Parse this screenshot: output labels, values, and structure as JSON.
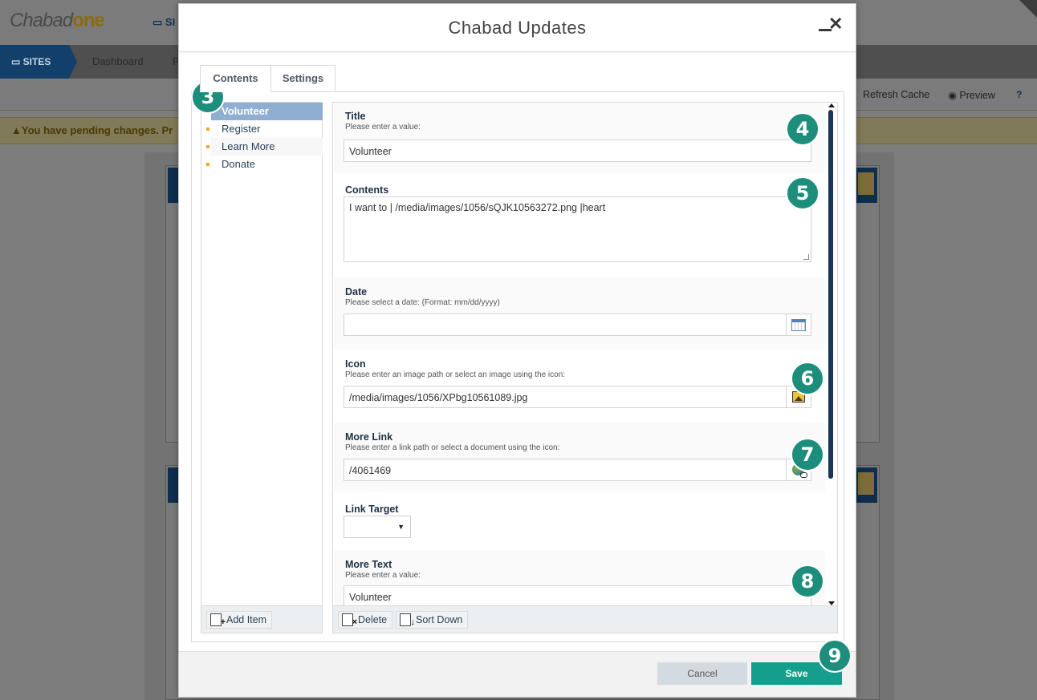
{
  "background": {
    "logo_prefix": "Chabad",
    "logo_suffix": "one",
    "site_label": "SI",
    "nav": {
      "sites": "SITES",
      "dashboard": "Dashboard",
      "next": "P"
    },
    "toolbar": {
      "refresh": "Refresh Cache",
      "preview": "Preview",
      "help": "?"
    },
    "pending": "You have pending changes. Pr"
  },
  "modal": {
    "title": "Chabad Updates",
    "tabs": [
      "Contents",
      "Settings"
    ],
    "list_items": [
      {
        "label": "Volunteer",
        "selected": true
      },
      {
        "label": "Register"
      },
      {
        "label": "Learn More"
      },
      {
        "label": "Donate"
      }
    ],
    "add_item": "Add Item",
    "delete": "Delete",
    "sort_down": "Sort Down",
    "fields": {
      "title": {
        "label": "Title",
        "help": "Please enter a value:",
        "value": "Volunteer"
      },
      "contents": {
        "label": "Contents",
        "value": "I want to | /media/images/1056/sQJK10563272.png |heart"
      },
      "date": {
        "label": "Date",
        "help": "Please select a date: (Format: mm/dd/yyyy)",
        "value": ""
      },
      "icon": {
        "label": "Icon",
        "help": "Please enter an image path or select an image using the icon:",
        "value": "/media/images/1056/XPbg10561089.jpg"
      },
      "more_link": {
        "label": "More Link",
        "help": "Please enter a link path or select a document using the icon:",
        "value": "/4061469"
      },
      "link_target": {
        "label": "Link Target",
        "value": ""
      },
      "more_text": {
        "label": "More Text",
        "help": "Please enter a value:",
        "value": "Volunteer"
      }
    },
    "cancel": "Cancel",
    "save": "Save"
  },
  "badges": [
    "3",
    "4",
    "5",
    "6",
    "7",
    "8",
    "9"
  ],
  "colors": {
    "accent": "#139f8c",
    "badge": "#1e8e7c",
    "selected": "#8faed1",
    "nav": "#12406a"
  }
}
